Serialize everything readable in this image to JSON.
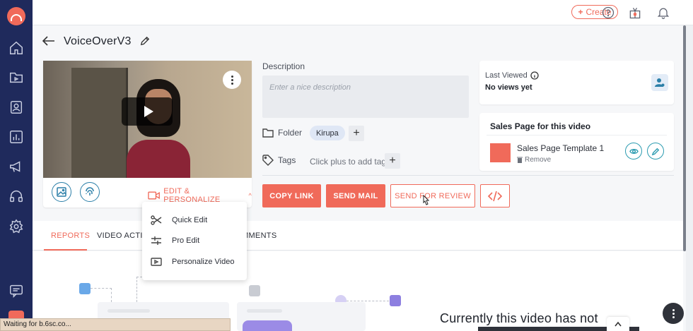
{
  "sidebar": {
    "items": [
      {
        "name": "home-icon"
      },
      {
        "name": "folder-icon"
      },
      {
        "name": "contacts-icon"
      },
      {
        "name": "analytics-icon"
      },
      {
        "name": "megaphone-icon"
      },
      {
        "name": "headset-icon"
      },
      {
        "name": "settings-icon"
      },
      {
        "name": "chat-icon"
      }
    ]
  },
  "topbar": {
    "create_label": "Create",
    "icons": [
      "help-icon",
      "rewards-icon",
      "notification-bell-icon"
    ]
  },
  "video": {
    "title": "VoiceOverV3",
    "edit_personalize_label": "EDIT & PERSONALIZE"
  },
  "edit_menu": {
    "items": [
      "Quick Edit",
      "Pro Edit",
      "Personalize Video"
    ]
  },
  "details": {
    "description_label": "Description",
    "description_placeholder": "Enter a nice description",
    "folder_label": "Folder",
    "folder_value": "Kirupa",
    "tags_label": "Tags",
    "tags_hint": "Click plus to add tags"
  },
  "actions": {
    "copy_link": "COPY LINK",
    "send_mail": "SEND MAIL",
    "send_for_review": "SEND FOR REVIEW"
  },
  "last_viewed": {
    "label": "Last Viewed",
    "value": "No views yet"
  },
  "sales_page": {
    "title": "Sales Page for this video",
    "template_name": "Sales Page Template 1",
    "remove_label": "Remove"
  },
  "tabs": [
    {
      "label": "REPORTS",
      "active": true
    },
    {
      "label": "VIDEO ACTIO"
    },
    {
      "label": "MMENTS"
    }
  ],
  "empty_state": {
    "message": "Currently this video has not"
  },
  "browser_status": "Waiting for b.6sc.co...",
  "colors": {
    "accent": "#f06a5a",
    "sidebar": "#1f2a5c",
    "teal": "#2b7fa8"
  }
}
